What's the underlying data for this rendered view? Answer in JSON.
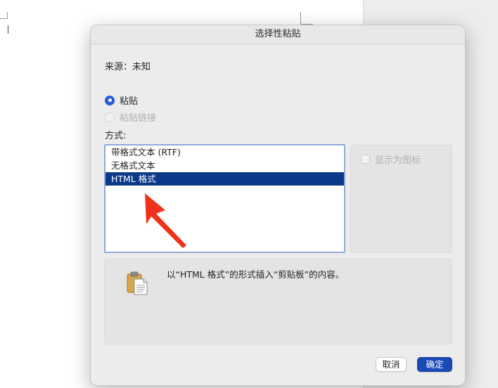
{
  "dialog": {
    "title": "选择性粘贴",
    "source_text": "来源：未知",
    "paste_options": [
      {
        "label": "粘贴",
        "selected": true,
        "enabled": true
      },
      {
        "label": "粘贴链接",
        "selected": false,
        "enabled": false
      }
    ],
    "method_label": "方式:",
    "formats": [
      {
        "label": "带格式文本 (RTF)",
        "selected": false
      },
      {
        "label": "无格式文本",
        "selected": false
      },
      {
        "label": "HTML 格式",
        "selected": true
      }
    ],
    "display_as_icon_label": "显示为图标",
    "display_as_icon_checked": false,
    "result_icon": "clipboard-icon",
    "result_text": "以“HTML 格式”的形式插入“剪贴板”的内容。",
    "cancel_label": "取消",
    "ok_label": "确定"
  },
  "colors": {
    "accent": "#2a5bd7",
    "selection": "#0c3a8a",
    "annotation_arrow": "#f0321c"
  }
}
